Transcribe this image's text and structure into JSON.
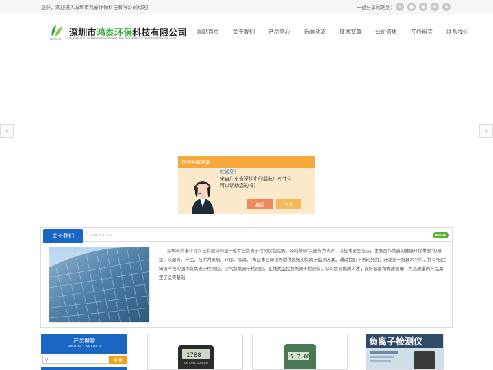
{
  "topbar": {
    "welcome": "您好，欢迎进入深圳市鸿泰环保科技有限公司网站！",
    "share_label": "一键分享网站到：",
    "share_icons": [
      "plus-icon",
      "wechat-icon",
      "weibo-icon",
      "qq-zone-icon",
      "qq-icon"
    ]
  },
  "header": {
    "logo_cn_part1": "深圳市",
    "logo_cn_part2": "鸿泰环保",
    "logo_cn_part3": "科技有限公司",
    "logo_en": "SHENZHEN HONGTAI ENVIRONMENTAL PROTECTION TECHNOLOGY CO., LTD."
  },
  "nav": {
    "items": [
      "网站首页",
      "关于我们",
      "产品中心",
      "新闻动态",
      "技术文章",
      "公司资质",
      "在线留言",
      "联系我们"
    ]
  },
  "banner": {
    "prev_arrow": "‹",
    "next_arrow": "›"
  },
  "chat": {
    "title": "在线客服咨询",
    "greeting": "欢迎您！",
    "line1": "来自广东省深圳市的朋友！有什么",
    "line2": "可以帮助您的吗？",
    "accept": "接受",
    "later": "下次"
  },
  "about": {
    "tab_label": "关于我们",
    "separator": "/",
    "tab_en": "ABOUT US",
    "more": "MORE",
    "text": "深圳市鸿泰环保科技有限公司是一家专业负离子检测仪制造商，公司秉承“以服务为先导，以技术安全核心，发展合作共赢的健康环保事业”的理念，以服务、产品、技术为家居、环保、高效。“寄企事业单位等提供系统的负离子监测方案。通过我们不断的努力，开发出一批具水平的，拥有*自主知识产权的固体负氧离子检测仪，空气负氧离子检测仪、在线式监控负氧离子检测仪，公司拥有优质人才，良好设备和优质管理，为高质量的产品奠定了坚实基础"
  },
  "sidebar": {
    "search_title": "产品搜索",
    "search_title_en": "PRODUCT SEARCH",
    "search_button": "搜 索"
  },
  "products": {
    "p1_label": "AIR ION COUNTER",
    "p1_display": "1788",
    "p2_display": "5.7.00",
    "p3_banner": "负离子检测仪"
  },
  "colors": {
    "brand_blue": "#1a66c3",
    "brand_green": "#3aa93d",
    "accent_orange": "#f5a93c"
  }
}
